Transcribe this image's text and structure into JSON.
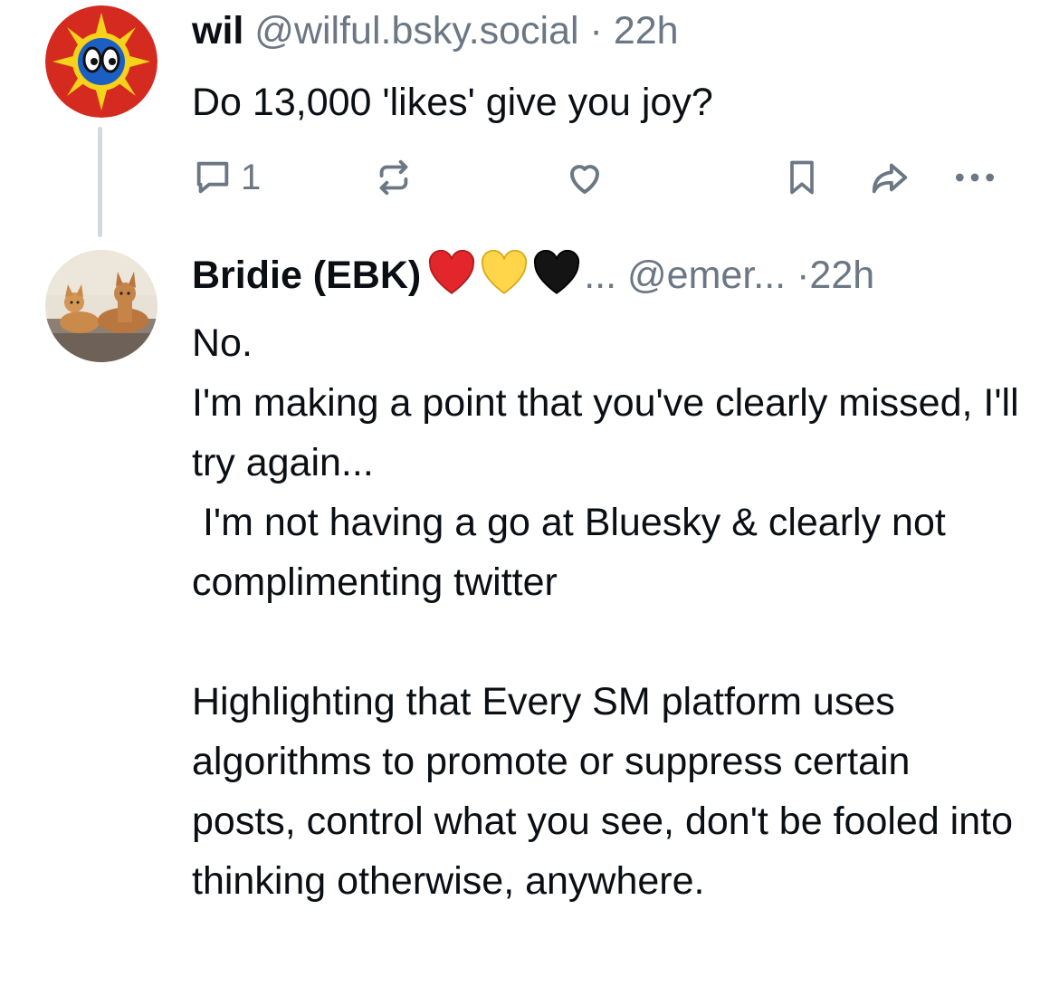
{
  "colors": {
    "text": "#0b0f14",
    "muted": "#6b7784",
    "thread_line": "#d4d9df"
  },
  "posts": [
    {
      "author": "wil",
      "handle": "@wilful.bsky.social",
      "separator": "·",
      "time": "22h",
      "text": "Do 13,000 'likes' give you joy?",
      "actions": {
        "reply_icon": "reply-icon",
        "reply_count": "1",
        "repost_icon": "repost-icon",
        "like_icon": "like-icon",
        "bookmark_icon": "bookmark-icon",
        "share_icon": "share-icon",
        "more_icon": "more-icon"
      }
    },
    {
      "author": "Bridie (EBK)",
      "emoji": [
        "red-heart",
        "yellow-heart",
        "black-heart"
      ],
      "name_truncation": "...",
      "handle": "@emer...",
      "separator": "·",
      "time": "22h",
      "paragraphs": [
        "No.",
        "I'm making a point that you've clearly missed, I'll try again...",
        " I'm not having a go at Bluesky & clearly not complimenting twitter",
        "",
        "Highlighting that Every SM platform uses algorithms to promote or suppress certain posts, control what you see, don't be fooled into thinking otherwise, anywhere."
      ]
    }
  ]
}
